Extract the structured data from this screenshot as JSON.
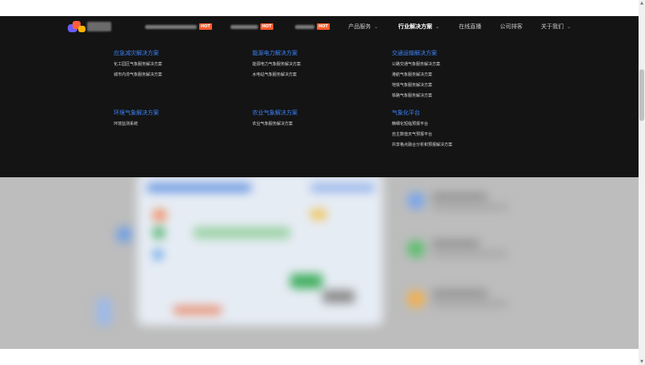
{
  "nav": {
    "hot_badge": "HOT",
    "chevron": "⌄",
    "items": [
      {
        "label": "产品服务"
      },
      {
        "label": "行业解决方案"
      },
      {
        "label": "在线直播"
      },
      {
        "label": "公司排客"
      },
      {
        "label": "关于我们"
      }
    ]
  },
  "dropdown": {
    "groups": [
      {
        "title": "应急减灾解决方案",
        "items": [
          "化工园区气象服务解决方案",
          "城市内涝气象服务解决方案"
        ]
      },
      {
        "title": "能源电力解决方案",
        "items": [
          "能源电力气象服务解决方案",
          "水电站气象服务解决方案"
        ]
      },
      {
        "title": "交通运输解决方案",
        "items": [
          "公路交通气象服务解决方案",
          "港航气象服务解决方案",
          "地铁气象服务解决方案",
          "铁路气象服务解决方案"
        ]
      },
      {
        "title": "环境气象解决方案",
        "items": [
          "环境监测系统"
        ]
      },
      {
        "title": "农业气象解决方案",
        "items": [
          "农业气象服务解决方案"
        ]
      },
      {
        "title": "气象化平台",
        "items": [
          "精细化短临预报平台",
          "自主数值天气预报平台",
          "共享格点融合分析和预报解决方案"
        ]
      }
    ]
  },
  "colors": {
    "nav_bg": "#141414",
    "group_title": "#3b82f6",
    "hot_badge": "#ff5a2c"
  },
  "scrollbar": {
    "up_arrow": "▲",
    "down_arrow": "▼"
  }
}
